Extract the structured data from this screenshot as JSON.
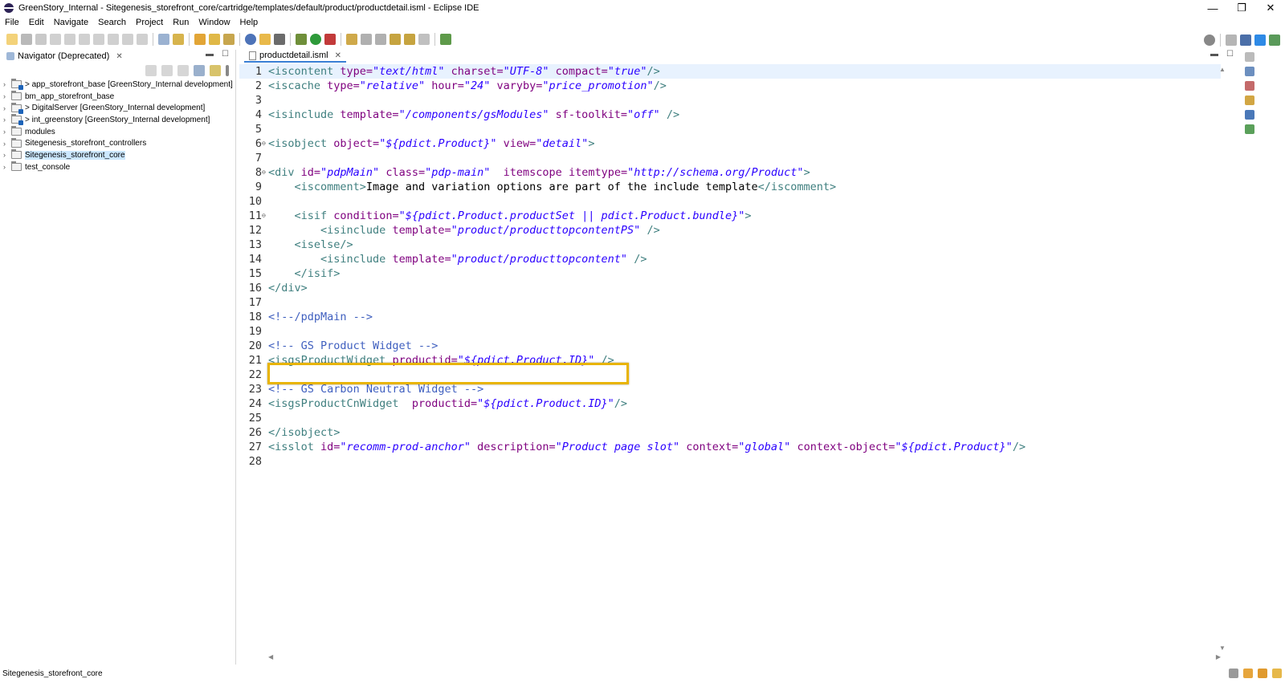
{
  "window": {
    "title": "GreenStory_Internal - Sitegenesis_storefront_core/cartridge/templates/default/product/productdetail.isml - Eclipse IDE",
    "minimize": "—",
    "restore": "❐",
    "close": "✕"
  },
  "menu": [
    "File",
    "Edit",
    "Navigate",
    "Search",
    "Project",
    "Run",
    "Window",
    "Help"
  ],
  "navigator": {
    "tab_label": "Navigator (Deprecated)",
    "items": [
      {
        "label": "> app_storefront_base [GreenStory_Internal development]",
        "git": true,
        "selected": false
      },
      {
        "label": "bm_app_storefront_base",
        "git": false,
        "selected": false
      },
      {
        "label": "> DigitalServer [GreenStory_Internal development]",
        "git": true,
        "selected": false
      },
      {
        "label": "> int_greenstory [GreenStory_Internal development]",
        "git": true,
        "selected": false
      },
      {
        "label": "modules",
        "git": false,
        "selected": false
      },
      {
        "label": "Sitegenesis_storefront_controllers",
        "git": false,
        "selected": false
      },
      {
        "label": "Sitegenesis_storefront_core",
        "git": false,
        "selected": true
      },
      {
        "label": "test_console",
        "git": false,
        "selected": false
      }
    ]
  },
  "editor": {
    "tab_label": "productdetail.isml",
    "lines": [
      {
        "n": "1",
        "fold": "",
        "tokens": [
          [
            "t",
            "<iscontent "
          ],
          [
            "a",
            "type="
          ],
          [
            "v",
            "\"text/html\""
          ],
          [
            "p",
            " "
          ],
          [
            "a",
            "charset="
          ],
          [
            "v",
            "\"UTF-8\""
          ],
          [
            "p",
            " "
          ],
          [
            "a",
            "compact="
          ],
          [
            "v",
            "\"true\""
          ],
          [
            "t",
            "/>"
          ]
        ]
      },
      {
        "n": "2",
        "fold": "",
        "tokens": [
          [
            "t",
            "<iscache "
          ],
          [
            "a",
            "type="
          ],
          [
            "v",
            "\"relative\""
          ],
          [
            "p",
            " "
          ],
          [
            "a",
            "hour="
          ],
          [
            "v",
            "\"24\""
          ],
          [
            "p",
            " "
          ],
          [
            "a",
            "varyby="
          ],
          [
            "v",
            "\"price_promotion\""
          ],
          [
            "t",
            "/>"
          ]
        ]
      },
      {
        "n": "3",
        "fold": "",
        "tokens": []
      },
      {
        "n": "4",
        "fold": "",
        "tokens": [
          [
            "t",
            "<isinclude "
          ],
          [
            "a",
            "template="
          ],
          [
            "v",
            "\"/components/gsModules\""
          ],
          [
            "p",
            " "
          ],
          [
            "a",
            "sf-toolkit="
          ],
          [
            "v",
            "\"off\""
          ],
          [
            "p",
            " "
          ],
          [
            "t",
            "/>"
          ]
        ]
      },
      {
        "n": "5",
        "fold": "",
        "tokens": []
      },
      {
        "n": "6",
        "fold": "⊖",
        "tokens": [
          [
            "t",
            "<isobject "
          ],
          [
            "a",
            "object="
          ],
          [
            "v",
            "\"${pdict.Product}\""
          ],
          [
            "p",
            " "
          ],
          [
            "a",
            "view="
          ],
          [
            "v",
            "\"detail\""
          ],
          [
            "t",
            ">"
          ]
        ]
      },
      {
        "n": "7",
        "fold": "",
        "tokens": []
      },
      {
        "n": "8",
        "fold": "⊖",
        "tokens": [
          [
            "t",
            "<div "
          ],
          [
            "a",
            "id="
          ],
          [
            "v",
            "\"pdpMain\""
          ],
          [
            "p",
            " "
          ],
          [
            "a",
            "class="
          ],
          [
            "v",
            "\"pdp-main\""
          ],
          [
            "p",
            "  "
          ],
          [
            "a",
            "itemscope"
          ],
          [
            "p",
            " "
          ],
          [
            "a",
            "itemtype="
          ],
          [
            "v",
            "\"http://schema.org/Product\""
          ],
          [
            "t",
            ">"
          ]
        ]
      },
      {
        "n": "9",
        "fold": "",
        "tokens": [
          [
            "p",
            "    "
          ],
          [
            "t",
            "<iscomment>"
          ],
          [
            "p",
            "Image and variation options are part of the include template"
          ],
          [
            "t",
            "</iscomment>"
          ]
        ]
      },
      {
        "n": "10",
        "fold": "",
        "tokens": []
      },
      {
        "n": "11",
        "fold": "⊖",
        "tokens": [
          [
            "p",
            "    "
          ],
          [
            "t",
            "<isif "
          ],
          [
            "a",
            "condition="
          ],
          [
            "v",
            "\"${pdict.Product.productSet || pdict.Product.bundle}\""
          ],
          [
            "t",
            ">"
          ]
        ]
      },
      {
        "n": "12",
        "fold": "",
        "tokens": [
          [
            "p",
            "        "
          ],
          [
            "t",
            "<isinclude "
          ],
          [
            "a",
            "template="
          ],
          [
            "v",
            "\"product/producttopcontentPS\""
          ],
          [
            "p",
            " "
          ],
          [
            "t",
            "/>"
          ]
        ]
      },
      {
        "n": "13",
        "fold": "",
        "tokens": [
          [
            "p",
            "    "
          ],
          [
            "t",
            "<iselse/>"
          ]
        ]
      },
      {
        "n": "14",
        "fold": "",
        "tokens": [
          [
            "p",
            "        "
          ],
          [
            "t",
            "<isinclude "
          ],
          [
            "a",
            "template="
          ],
          [
            "v",
            "\"product/producttopcontent\""
          ],
          [
            "p",
            " "
          ],
          [
            "t",
            "/>"
          ]
        ]
      },
      {
        "n": "15",
        "fold": "",
        "tokens": [
          [
            "p",
            "    "
          ],
          [
            "t",
            "</isif>"
          ]
        ]
      },
      {
        "n": "16",
        "fold": "",
        "tokens": [
          [
            "t",
            "</div>"
          ]
        ]
      },
      {
        "n": "17",
        "fold": "",
        "tokens": []
      },
      {
        "n": "18",
        "fold": "",
        "tokens": [
          [
            "c",
            "<!--/pdpMain -->"
          ]
        ]
      },
      {
        "n": "19",
        "fold": "",
        "tokens": []
      },
      {
        "n": "20",
        "fold": "",
        "tokens": [
          [
            "c",
            "<!-- GS Product Widget -->"
          ]
        ]
      },
      {
        "n": "21",
        "fold": "",
        "tokens": [
          [
            "t",
            "<isgsProductWidget "
          ],
          [
            "a",
            "productid="
          ],
          [
            "v",
            "\"${pdict.Product.ID}\""
          ],
          [
            "p",
            " "
          ],
          [
            "t",
            "/>"
          ]
        ]
      },
      {
        "n": "22",
        "fold": "",
        "tokens": []
      },
      {
        "n": "23",
        "fold": "",
        "tokens": [
          [
            "c",
            "<!-- GS Carbon Neutral Widget -->"
          ]
        ]
      },
      {
        "n": "24",
        "fold": "",
        "tokens": [
          [
            "t",
            "<isgsProductCnWidget  "
          ],
          [
            "a",
            "productid="
          ],
          [
            "v",
            "\"${pdict.Product.ID}\""
          ],
          [
            "t",
            "/>"
          ]
        ]
      },
      {
        "n": "25",
        "fold": "",
        "tokens": []
      },
      {
        "n": "26",
        "fold": "",
        "tokens": [
          [
            "t",
            "</isobject>"
          ]
        ]
      },
      {
        "n": "27",
        "fold": "",
        "tokens": [
          [
            "t",
            "<isslot "
          ],
          [
            "a",
            "id="
          ],
          [
            "v",
            "\"recomm-prod-anchor\""
          ],
          [
            "p",
            " "
          ],
          [
            "a",
            "description="
          ],
          [
            "v",
            "\"Product page slot\""
          ],
          [
            "p",
            " "
          ],
          [
            "a",
            "context="
          ],
          [
            "v",
            "\"global\""
          ],
          [
            "p",
            " "
          ],
          [
            "a",
            "context-object="
          ],
          [
            "v",
            "\"${pdict.Product}\""
          ],
          [
            "t",
            "/>"
          ]
        ]
      },
      {
        "n": "28",
        "fold": "",
        "tokens": []
      }
    ],
    "highlighted_line": "21"
  },
  "status": {
    "text": "Sitegenesis_storefront_core"
  },
  "colors": {
    "tag": "#3f7f7f",
    "attribute": "#7f007f",
    "value": "#2a00ff",
    "comment": "#3f5fbf",
    "highlight_border": "#e8b400",
    "selection": "#cce8ff"
  }
}
